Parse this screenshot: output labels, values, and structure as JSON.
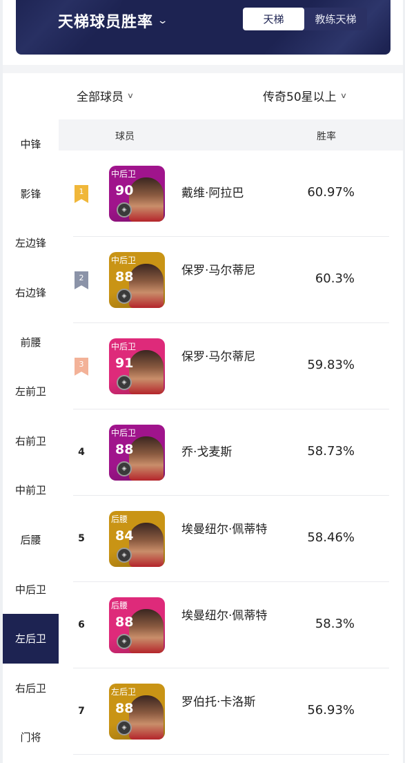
{
  "header": {
    "title": "天梯球员胜率",
    "tabs": [
      "天梯",
      "教练天梯"
    ],
    "active_tab": 0
  },
  "filters": {
    "players": "全部球员",
    "level": "传奇50星以上"
  },
  "sidebar": {
    "items": [
      "中锋",
      "影锋",
      "左边锋",
      "右边锋",
      "前腰",
      "左前卫",
      "右前卫",
      "中前卫",
      "后腰",
      "中后卫",
      "左后卫",
      "右后卫",
      "门将"
    ],
    "active_index": 10
  },
  "table": {
    "headers": {
      "player": "球员",
      "winrate": "胜率"
    },
    "rows": [
      {
        "rank": "1",
        "medal": "gold",
        "position": "中后卫",
        "rating": "90",
        "name": "戴维·阿拉巴",
        "winrate": "60.97%",
        "card_color": "purple"
      },
      {
        "rank": "2",
        "medal": "silver",
        "position": "中后卫",
        "rating": "88",
        "name": "保罗·马尔蒂尼",
        "winrate": "60.3%",
        "card_color": "gold"
      },
      {
        "rank": "3",
        "medal": "bronze",
        "position": "中后卫",
        "rating": "91",
        "name": "保罗·马尔蒂尼",
        "winrate": "59.83%",
        "card_color": "pink"
      },
      {
        "rank": "4",
        "medal": "",
        "position": "中后卫",
        "rating": "88",
        "name": "乔·戈麦斯",
        "winrate": "58.73%",
        "card_color": "purple"
      },
      {
        "rank": "5",
        "medal": "",
        "position": "后腰",
        "rating": "84",
        "name": "埃曼纽尔·佩蒂特",
        "winrate": "58.46%",
        "card_color": "gold"
      },
      {
        "rank": "6",
        "medal": "",
        "position": "后腰",
        "rating": "88",
        "name": "埃曼纽尔·佩蒂特",
        "winrate": "58.3%",
        "card_color": "pink"
      },
      {
        "rank": "7",
        "medal": "",
        "position": "左后卫",
        "rating": "88",
        "name": "罗伯托·卡洛斯",
        "winrate": "56.93%",
        "card_color": "gold"
      }
    ]
  },
  "colors": {
    "navy": "#1d2352",
    "medal_gold": "#f0b73a",
    "medal_silver": "#8b93a8",
    "medal_bronze": "#f3b298",
    "card_purple": "#a0148c",
    "card_gold": "#c99415",
    "card_pink": "#de2a7a"
  }
}
